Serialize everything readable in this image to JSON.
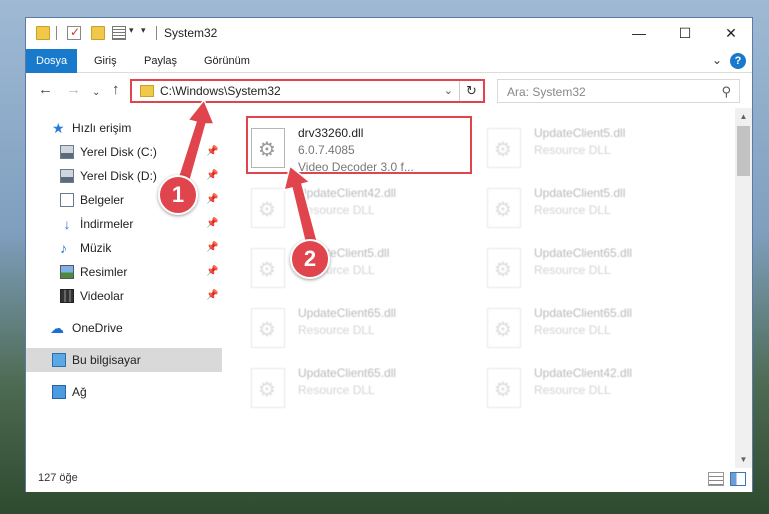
{
  "window": {
    "title": "System32",
    "controls": {
      "minimize": "—",
      "maximize": "☐",
      "close": "✕"
    }
  },
  "ribbon": {
    "tabs": [
      {
        "label": "Dosya",
        "active": true
      },
      {
        "label": "Giriş"
      },
      {
        "label": "Paylaş"
      },
      {
        "label": "Görünüm"
      }
    ],
    "help": "?",
    "collapse": "⌄"
  },
  "nav": {
    "back": "←",
    "forward": "→",
    "recent": "⌄",
    "up": "↑"
  },
  "address": {
    "path": "C:\\Windows\\System32",
    "dropdown": "⌄",
    "refresh": "↻"
  },
  "search": {
    "placeholder": "Ara: System32",
    "icon": "⚲"
  },
  "sidebar": {
    "items": [
      {
        "label": "Hızlı erişim",
        "icon": "star-icon",
        "pinned": false
      },
      {
        "label": "Yerel Disk (C:)",
        "icon": "drive-icon",
        "pinned": true
      },
      {
        "label": "Yerel Disk (D:)",
        "icon": "drive-icon",
        "pinned": true
      },
      {
        "label": "Belgeler",
        "icon": "documents-icon",
        "pinned": true
      },
      {
        "label": "İndirmeler",
        "icon": "downloads-icon",
        "pinned": true
      },
      {
        "label": "Müzik",
        "icon": "music-icon",
        "pinned": true
      },
      {
        "label": "Resimler",
        "icon": "pictures-icon",
        "pinned": true
      },
      {
        "label": "Videolar",
        "icon": "videos-icon",
        "pinned": true
      },
      {
        "label": "OneDrive",
        "icon": "cloud-icon",
        "pinned": false
      },
      {
        "label": "Bu bilgisayar",
        "icon": "computer-icon",
        "pinned": false,
        "selected": true
      },
      {
        "label": "Ağ",
        "icon": "network-icon",
        "pinned": false
      }
    ],
    "pin_glyph": "📌"
  },
  "files": [
    {
      "name": "drv33260.dll",
      "version": "6.0.7.4085",
      "desc": "Video Decoder 3.0 f...",
      "highlighted": true
    },
    {
      "name": "UpdateClient5.dll",
      "desc": "Resource DLL"
    },
    {
      "name": "UpdateClient42.dll",
      "desc": "Resource DLL"
    },
    {
      "name": "UpdateClient5.dll",
      "desc": "Resource DLL"
    },
    {
      "name": "UpdateClient5.dll",
      "desc": "Resource DLL"
    },
    {
      "name": "UpdateClient65.dll",
      "desc": "Resource DLL"
    },
    {
      "name": "UpdateClient65.dll",
      "desc": "Resource DLL"
    },
    {
      "name": "UpdateClient65.dll",
      "desc": "Resource DLL"
    },
    {
      "name": "UpdateClient65.dll",
      "desc": "Resource DLL"
    },
    {
      "name": "UpdateClient42.dll",
      "desc": "Resource DLL"
    }
  ],
  "status": {
    "count": "127 öğe"
  },
  "annotations": {
    "step1": "1",
    "step2": "2",
    "color": "#e0444c"
  }
}
